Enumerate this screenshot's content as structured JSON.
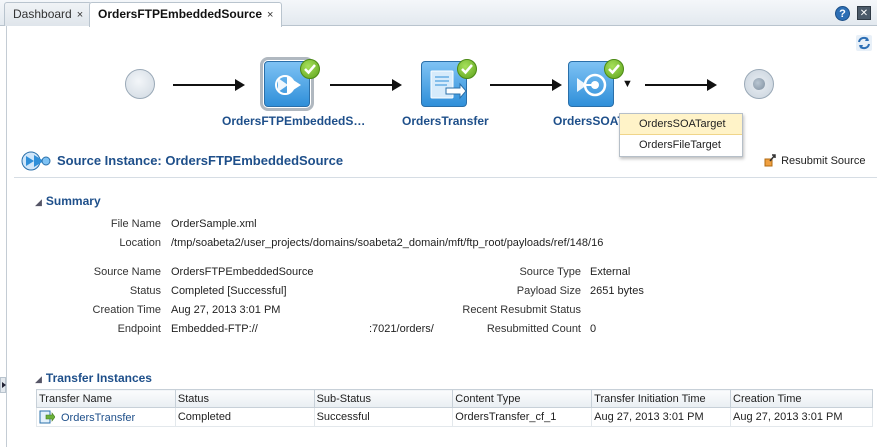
{
  "tabs": [
    {
      "label": "Dashboard",
      "close": "×"
    },
    {
      "label": "OrdersFTPEmbeddedSource",
      "close": "×"
    }
  ],
  "header_buttons": {
    "help": "?",
    "close": "✕"
  },
  "flow": {
    "nodes": [
      {
        "label": "OrdersFTPEmbeddedS…"
      },
      {
        "label": "OrdersTransfer"
      },
      {
        "label": "OrdersSOAT"
      }
    ],
    "dropdown_caret": "▼",
    "popup": [
      "OrdersSOATarget",
      "OrdersFileTarget"
    ]
  },
  "source": {
    "title": "Source Instance: OrdersFTPEmbeddedSource",
    "resubmit": "Resubmit Source"
  },
  "summary": {
    "title": "Summary",
    "file_name_label": "File Name",
    "file_name": "OrderSample.xml",
    "location_label": "Location",
    "location": "/tmp/soabeta2/user_projects/domains/soabeta2_domain/mft/ftp_root/payloads/ref/148/16",
    "source_name_label": "Source Name",
    "source_name": "OrdersFTPEmbeddedSource",
    "status_label": "Status",
    "status": "Completed [Successful]",
    "creation_time_label": "Creation Time",
    "creation_time": "Aug 27, 2013 3:01 PM",
    "endpoint_label": "Endpoint",
    "endpoint": "Embedded-FTP://",
    "endpoint_port": ":7021/orders/",
    "source_type_label": "Source Type",
    "source_type": "External",
    "payload_size_label": "Payload Size",
    "payload_size": "2651 bytes",
    "recent_resubmit_label": "Recent Resubmit Status",
    "recent_resubmit": "",
    "resubmitted_count_label": "Resubmitted Count",
    "resubmitted_count": "0"
  },
  "transfers": {
    "title": "Transfer Instances",
    "columns": [
      "Transfer Name",
      "Status",
      "Sub-Status",
      "Content Type",
      "Transfer Initiation Time",
      "Creation Time"
    ],
    "rows": [
      [
        "OrdersTransfer",
        "Completed",
        "Successful",
        "OrdersTransfer_cf_1",
        "Aug 27, 2013 3:01 PM",
        "Aug 27, 2013 3:01 PM"
      ]
    ]
  },
  "colors": {
    "link": "#1e4f8a",
    "accent": "#2f8fd9",
    "success": "#5ea31d"
  }
}
